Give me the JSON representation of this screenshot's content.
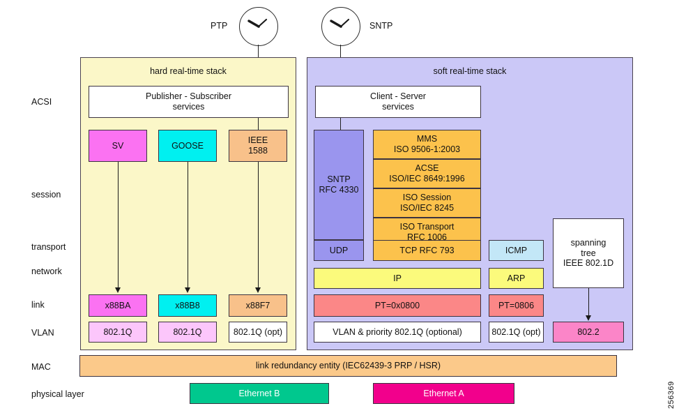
{
  "figure": {
    "reference_number": "256369"
  },
  "clocks": [
    {
      "name": "ptp-clock",
      "label": "PTP",
      "label_side": "left"
    },
    {
      "name": "sntp-clock",
      "label": "SNTP",
      "label_side": "right"
    }
  ],
  "row_labels": [
    {
      "id": "acsi",
      "label": "ACSI"
    },
    {
      "id": "session",
      "label": "session"
    },
    {
      "id": "transport",
      "label": "transport"
    },
    {
      "id": "network",
      "label": "network"
    },
    {
      "id": "link",
      "label": "link"
    },
    {
      "id": "vlan",
      "label": "VLAN"
    },
    {
      "id": "mac",
      "label": "MAC"
    },
    {
      "id": "physical",
      "label": "physical layer"
    }
  ],
  "hard_stack": {
    "title": "hard real-time stack",
    "background": "#fbf7c8",
    "services": {
      "line1": "Publisher - Subscriber",
      "line2": "services"
    },
    "protocols": [
      {
        "id": "sv",
        "line1": "SV",
        "line2": "",
        "color": "#fb72f2"
      },
      {
        "id": "goose",
        "line1": "GOOSE",
        "line2": "",
        "color": "#00f0f0"
      },
      {
        "id": "ieee1588",
        "line1": "IEEE",
        "line2": "1588",
        "color": "#f8c18a"
      }
    ],
    "ethertypes": [
      {
        "id": "x88ba",
        "label": "x88BA",
        "color": "#fb72f2"
      },
      {
        "id": "x88b8",
        "label": "x88B8",
        "color": "#00f0f0"
      },
      {
        "id": "x88f7",
        "label": "x88F7",
        "color": "#f8c18a"
      }
    ],
    "vlans": [
      {
        "id": "vlan-sv",
        "label": "802.1Q",
        "color": "#fcc6fb"
      },
      {
        "id": "vlan-goose",
        "label": "802.1Q",
        "color": "#fcc6fb"
      },
      {
        "id": "vlan-ieee1588",
        "label": "802.1Q (opt)",
        "color": "#ffffff"
      }
    ]
  },
  "soft_stack": {
    "title": "soft real-time stack",
    "background": "#cbc8f7",
    "services": {
      "line1": "Client - Server",
      "line2": "services"
    },
    "sntp": {
      "line1": "SNTP",
      "line2": "RFC 4330",
      "color": "#9a95ee"
    },
    "udp": {
      "label": "UDP",
      "color": "#9a95ee"
    },
    "osi_stack": [
      {
        "id": "mms",
        "line1": "MMS",
        "line2": "ISO 9506-1:2003",
        "color": "#fcc24c"
      },
      {
        "id": "acse",
        "line1": "ACSE",
        "line2": "ISO/IEC 8649:1996",
        "color": "#fcc24c"
      },
      {
        "id": "iso-session",
        "line1": "ISO Session",
        "line2": "ISO/IEC 8245",
        "color": "#fcc24c"
      },
      {
        "id": "iso-transport",
        "line1": "ISO Transport",
        "line2": "RFC 1006",
        "color": "#fcc24c"
      }
    ],
    "tcp": {
      "label": "TCP RFC 793",
      "color": "#fcc24c"
    },
    "icmp": {
      "label": "ICMP",
      "color": "#c3e7f7"
    },
    "ip": {
      "label": "IP",
      "color": "#fbfa7c"
    },
    "arp": {
      "label": "ARP",
      "color": "#fbfa7c"
    },
    "pt_ip": {
      "label": "PT=0x0800",
      "color": "#fb8787"
    },
    "pt_arp": {
      "label": "PT=0806",
      "color": "#fb8787"
    },
    "vlan_main": {
      "label": "VLAN & priority 802.1Q (optional)",
      "color": "#ffffff"
    },
    "vlan_arp": {
      "label": "802.1Q (opt)",
      "color": "#ffffff"
    },
    "spanning_tree": {
      "line1": "spanning",
      "line2": "tree",
      "line3": "IEEE 802.1D",
      "color": "#ffffff"
    },
    "llc": {
      "label": "802.2",
      "color": "#fb85c8"
    }
  },
  "mac_layer": {
    "label": "link redundancy entity (IEC62439-3 PRP / HSR)",
    "color": "#fbc98a"
  },
  "physical_layer": {
    "ports": [
      {
        "id": "ethernet-b",
        "label": "Ethernet B",
        "color": "#00c88e",
        "text_color": "#ffffff"
      },
      {
        "id": "ethernet-a",
        "label": "Ethernet A",
        "color": "#f2008c",
        "text_color": "#ffffff"
      }
    ]
  }
}
